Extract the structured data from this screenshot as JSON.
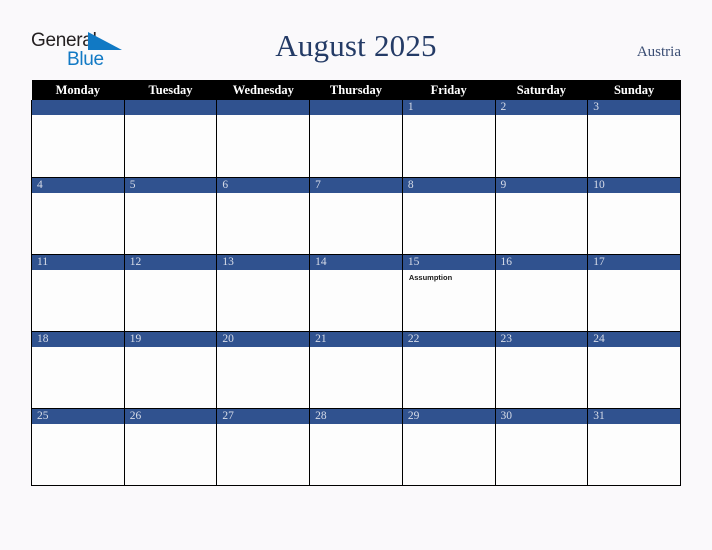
{
  "brand": {
    "name_part1": "General",
    "name_part2": "Blue",
    "triangle_color": "#1179c4"
  },
  "header": {
    "title": "August 2025",
    "country": "Austria"
  },
  "theme": {
    "header_row_bg": "#000000",
    "date_bar_bg": "#30528f",
    "date_text": "#d7dce8",
    "title_color": "#243b66",
    "page_bg": "#faf9fb",
    "cell_bg": "#fdfdfd",
    "grid_line": "#000000"
  },
  "calendar": {
    "month": "August",
    "year": "2025",
    "weekday_headers": [
      "Monday",
      "Tuesday",
      "Wednesday",
      "Thursday",
      "Friday",
      "Saturday",
      "Sunday"
    ],
    "weeks": [
      [
        {
          "date": "",
          "events": []
        },
        {
          "date": "",
          "events": []
        },
        {
          "date": "",
          "events": []
        },
        {
          "date": "",
          "events": []
        },
        {
          "date": "1",
          "events": []
        },
        {
          "date": "2",
          "events": []
        },
        {
          "date": "3",
          "events": []
        }
      ],
      [
        {
          "date": "4",
          "events": []
        },
        {
          "date": "5",
          "events": []
        },
        {
          "date": "6",
          "events": []
        },
        {
          "date": "7",
          "events": []
        },
        {
          "date": "8",
          "events": []
        },
        {
          "date": "9",
          "events": []
        },
        {
          "date": "10",
          "events": []
        }
      ],
      [
        {
          "date": "11",
          "events": []
        },
        {
          "date": "12",
          "events": []
        },
        {
          "date": "13",
          "events": []
        },
        {
          "date": "14",
          "events": []
        },
        {
          "date": "15",
          "events": [
            "Assumption"
          ]
        },
        {
          "date": "16",
          "events": []
        },
        {
          "date": "17",
          "events": []
        }
      ],
      [
        {
          "date": "18",
          "events": []
        },
        {
          "date": "19",
          "events": []
        },
        {
          "date": "20",
          "events": []
        },
        {
          "date": "21",
          "events": []
        },
        {
          "date": "22",
          "events": []
        },
        {
          "date": "23",
          "events": []
        },
        {
          "date": "24",
          "events": []
        }
      ],
      [
        {
          "date": "25",
          "events": []
        },
        {
          "date": "26",
          "events": []
        },
        {
          "date": "27",
          "events": []
        },
        {
          "date": "28",
          "events": []
        },
        {
          "date": "29",
          "events": []
        },
        {
          "date": "30",
          "events": []
        },
        {
          "date": "31",
          "events": []
        }
      ]
    ]
  }
}
